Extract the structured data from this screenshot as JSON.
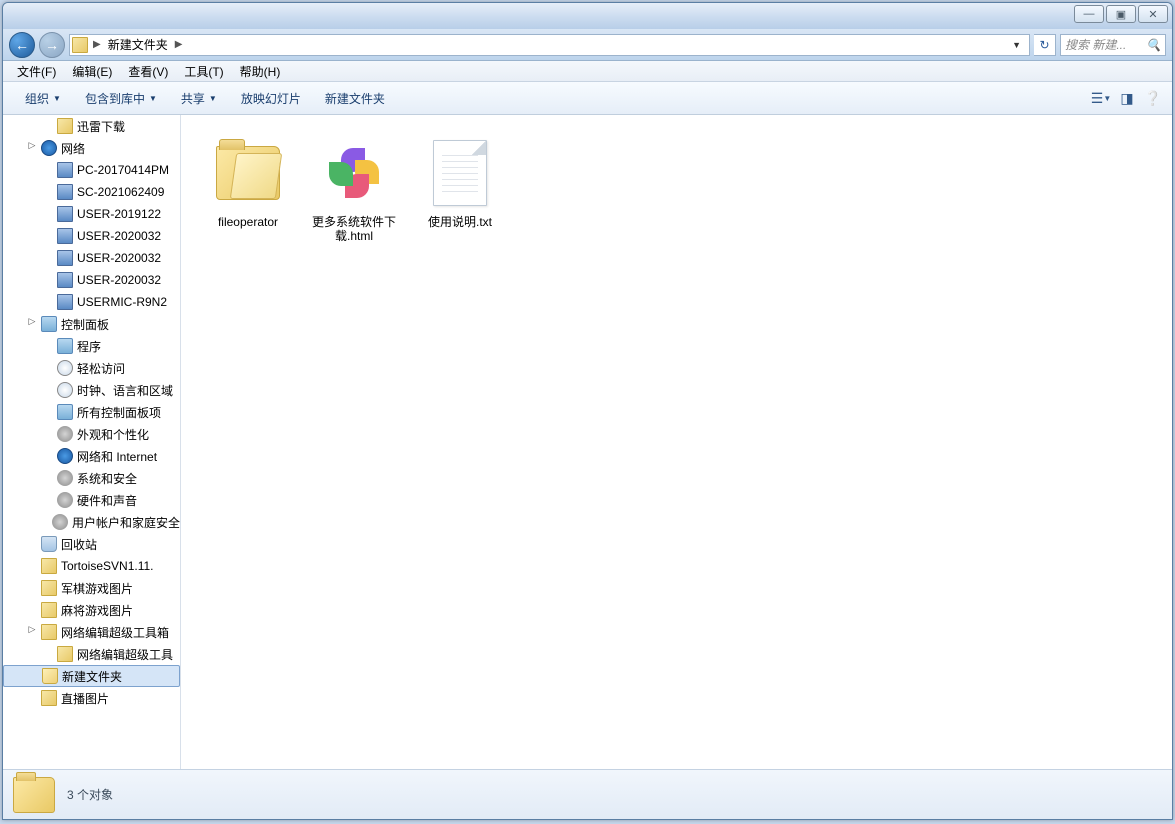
{
  "titlebar": {
    "min": "—",
    "max": "▣",
    "close": "✕"
  },
  "addressbar": {
    "current_folder": "新建文件夹",
    "refresh_glyph": "↻"
  },
  "search": {
    "placeholder": "搜索 新建..."
  },
  "menubar": [
    "文件(F)",
    "编辑(E)",
    "查看(V)",
    "工具(T)",
    "帮助(H)"
  ],
  "toolbar": {
    "organize": "组织",
    "include": "包含到库中",
    "share": "共享",
    "slideshow": "放映幻灯片",
    "newfolder": "新建文件夹"
  },
  "sidebar": [
    {
      "label": "迅雷下载",
      "level": 2,
      "icon": "folder"
    },
    {
      "label": "网络",
      "level": 1,
      "icon": "net",
      "expand": true
    },
    {
      "label": "PC-20170414PM",
      "level": 2,
      "icon": "pc"
    },
    {
      "label": "SC-2021062409",
      "level": 2,
      "icon": "pc"
    },
    {
      "label": "USER-2019122",
      "level": 2,
      "icon": "pc"
    },
    {
      "label": "USER-2020032",
      "level": 2,
      "icon": "pc"
    },
    {
      "label": "USER-2020032",
      "level": 2,
      "icon": "pc"
    },
    {
      "label": "USER-2020032",
      "level": 2,
      "icon": "pc"
    },
    {
      "label": "USERMIC-R9N2",
      "level": 2,
      "icon": "pc"
    },
    {
      "label": "控制面板",
      "level": 1,
      "icon": "cpl",
      "expand": true
    },
    {
      "label": "程序",
      "level": 2,
      "icon": "cpl"
    },
    {
      "label": "轻松访问",
      "level": 2,
      "icon": "clock"
    },
    {
      "label": "时钟、语言和区域",
      "level": 2,
      "icon": "clock"
    },
    {
      "label": "所有控制面板项",
      "level": 2,
      "icon": "cpl"
    },
    {
      "label": "外观和个性化",
      "level": 2,
      "icon": "gear"
    },
    {
      "label": "网络和 Internet",
      "level": 2,
      "icon": "net"
    },
    {
      "label": "系统和安全",
      "level": 2,
      "icon": "gear"
    },
    {
      "label": "硬件和声音",
      "level": 2,
      "icon": "gear"
    },
    {
      "label": "用户帐户和家庭安全",
      "level": 2,
      "icon": "gear"
    },
    {
      "label": "回收站",
      "level": 1,
      "icon": "recycle"
    },
    {
      "label": "TortoiseSVN1.11.",
      "level": 1,
      "icon": "folder"
    },
    {
      "label": "军棋游戏图片",
      "level": 1,
      "icon": "folder"
    },
    {
      "label": "麻将游戏图片",
      "level": 1,
      "icon": "folder"
    },
    {
      "label": "网络编辑超级工具箱",
      "level": 1,
      "icon": "folder",
      "expand": true
    },
    {
      "label": "网络编辑超级工具",
      "level": 2,
      "icon": "folder"
    },
    {
      "label": "新建文件夹",
      "level": 1,
      "icon": "folder-open",
      "selected": true
    },
    {
      "label": "直播图片",
      "level": 1,
      "icon": "folder"
    }
  ],
  "files": [
    {
      "name": "fileoperator",
      "type": "folder"
    },
    {
      "name": "更多系统软件下载.html",
      "type": "html"
    },
    {
      "name": "使用说明.txt",
      "type": "txt"
    }
  ],
  "statusbar": {
    "text": "3 个对象"
  }
}
